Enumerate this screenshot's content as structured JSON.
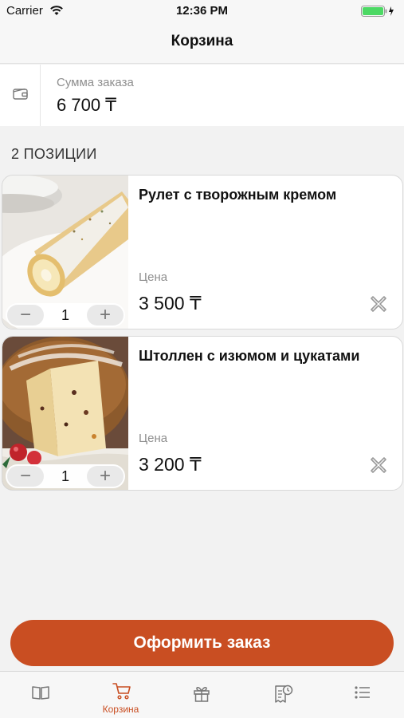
{
  "status_bar": {
    "carrier": "Carrier",
    "time": "12:36 PM"
  },
  "nav": {
    "title": "Корзина"
  },
  "summary": {
    "label": "Сумма заказа",
    "value": "6 700 ₸",
    "icon": "wallet-icon"
  },
  "cart": {
    "count_label": "2 ПОЗИЦИИ",
    "items": [
      {
        "title": "Рулет с творожным кремом",
        "price_label": "Цена",
        "price": "3 500 ₸",
        "quantity": "1",
        "image": "roll-cake-photo"
      },
      {
        "title": "Штоллен с изюмом и цукатами",
        "price_label": "Цена",
        "price": "3 200 ₸",
        "quantity": "1",
        "image": "stollen-photo"
      }
    ]
  },
  "checkout": {
    "label": "Оформить заказ"
  },
  "tabbar": {
    "active": "cart",
    "tabs": [
      {
        "id": "menu",
        "icon": "book-icon",
        "label": ""
      },
      {
        "id": "cart",
        "icon": "cart-icon",
        "label": "Корзина"
      },
      {
        "id": "gifts",
        "icon": "gift-icon",
        "label": ""
      },
      {
        "id": "history",
        "icon": "receipt-clock-icon",
        "label": ""
      },
      {
        "id": "more",
        "icon": "list-icon",
        "label": ""
      }
    ]
  },
  "colors": {
    "accent": "#c94e22",
    "background": "#f2f2f2",
    "battery": "#4cd964"
  }
}
